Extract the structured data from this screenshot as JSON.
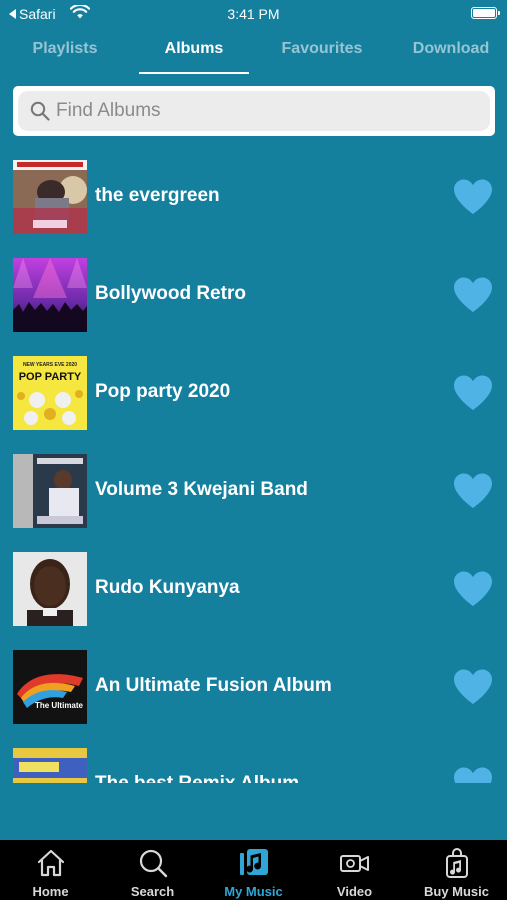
{
  "status_bar": {
    "back_app": "Safari",
    "time": "3:41 PM"
  },
  "tabs": [
    {
      "label": "Playlists",
      "active": false
    },
    {
      "label": "Albums",
      "active": true
    },
    {
      "label": "Favourites",
      "active": false
    },
    {
      "label": "Download",
      "active": false
    }
  ],
  "search": {
    "placeholder": "Find Albums",
    "value": ""
  },
  "albums": [
    {
      "title": "the evergreen",
      "favorite": true
    },
    {
      "title": "Bollywood Retro",
      "favorite": true
    },
    {
      "title": "Pop party 2020",
      "favorite": true,
      "cover_text": "NEW YEARS EVE 2020 POP PARTY"
    },
    {
      "title": "Volume 3 Kwejani Band",
      "favorite": true
    },
    {
      "title": "Rudo Kunyanya",
      "favorite": true
    },
    {
      "title": "An Ultimate Fusion Album",
      "favorite": true,
      "cover_text": "The Ultimate"
    },
    {
      "title": "The best Remix Album",
      "favorite": true
    }
  ],
  "bottom_nav": [
    {
      "label": "Home",
      "icon": "home-icon",
      "active": false
    },
    {
      "label": "Search",
      "icon": "search-icon",
      "active": false
    },
    {
      "label": "My Music",
      "icon": "music-library-icon",
      "active": true
    },
    {
      "label": "Video",
      "icon": "video-camera-icon",
      "active": false
    },
    {
      "label": "Buy Music",
      "icon": "music-bag-icon",
      "active": false
    }
  ],
  "colors": {
    "background": "#157f9e",
    "heart": "#4fb3e6",
    "nav_active": "#2fa6d8",
    "nav_background": "#000000"
  }
}
